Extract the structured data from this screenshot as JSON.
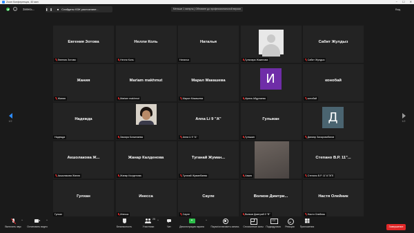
{
  "window": {
    "title": "Zoom Конференция, 40 мин",
    "controls": [
      "−",
      "☐",
      "✕"
    ]
  },
  "topbar": {
    "recording_label": "Запись...",
    "pill_controls": "❚❚ ■",
    "share_label": "Слайдаты ЮЖ распознают...",
    "notice": "Меньше 1 минуты | Обновите до профессиональной версии",
    "view_label": "Вид"
  },
  "pager": {
    "left": "1/2",
    "right": "1/2"
  },
  "colors": {
    "accent": "#2d8cff",
    "danger": "#e02828",
    "share": "#2dbf4a"
  },
  "tiles": [
    {
      "name": "Евгения Зотова",
      "label": "Евгения Зотова",
      "muted": true,
      "avatar": "none"
    },
    {
      "name": "Нелли Коль",
      "label": "Нелли Коль",
      "muted": true,
      "avatar": "none"
    },
    {
      "name": "Наталья",
      "label": "Наталья",
      "muted": false,
      "avatar": "none"
    },
    {
      "name": "",
      "label": "Гульнара Жакенова",
      "muted": true,
      "avatar": "photo-placeholder"
    },
    {
      "name": "Сабит Жулдыз",
      "label": "Сабит Жулдыз",
      "muted": true,
      "avatar": "none"
    },
    {
      "name": "Жания",
      "label": "Жания",
      "muted": true,
      "avatar": "none"
    },
    {
      "name": "Mariam makhmut",
      "label": "Mariam makhmut",
      "muted": true,
      "avatar": "none"
    },
    {
      "name": "Марал Макашева",
      "label": "Марал Макашева",
      "muted": true,
      "avatar": "none"
    },
    {
      "name": "",
      "label": "Ирина Абдулаева",
      "muted": true,
      "avatar": "letter",
      "letter": "И",
      "color": "#6f2da8"
    },
    {
      "name": "конобай",
      "label": "конобай",
      "muted": true,
      "avatar": "none"
    },
    {
      "name": "Надежда",
      "label": "Надежда",
      "muted": false,
      "avatar": "none"
    },
    {
      "name": "",
      "label": "Замира Конкатаева",
      "muted": true,
      "avatar": "face"
    },
    {
      "name": "Anna Li 9 \"A\"",
      "label": "Anna Li 9 \"A\"",
      "muted": true,
      "avatar": "none"
    },
    {
      "name": "Гульжан",
      "label": "Гульжан",
      "muted": true,
      "avatar": "none"
    },
    {
      "name": "",
      "label": "Данияр Захаровибатов",
      "muted": true,
      "avatar": "letter",
      "letter": "Д",
      "color": "#4a6470"
    },
    {
      "name": "Акшолакова Ж...",
      "label": "Акшолакова Жания",
      "muted": true,
      "avatar": "none"
    },
    {
      "name": "Жанар Калденова",
      "label": "Жанар Калденова",
      "muted": true,
      "avatar": "none"
    },
    {
      "name": "Туганай Жуман...",
      "label": "Туганай Жуманбаева",
      "muted": true,
      "avatar": "none"
    },
    {
      "name": "",
      "label": "Хакия",
      "muted": true,
      "avatar": "video"
    },
    {
      "name": "Степано В.Р. 11\"...",
      "label": "Степано В.Р. 11\"А\"ЭГЕ",
      "muted": true,
      "avatar": "none"
    },
    {
      "name": "Гулхан",
      "label": "Гулхан",
      "muted": false,
      "avatar": "none"
    },
    {
      "name": "Инесса",
      "label": "Инесса",
      "muted": true,
      "avatar": "none"
    },
    {
      "name": "Сауле",
      "label": "Сауле",
      "muted": true,
      "avatar": "none"
    },
    {
      "name": "Волков Дмитри...",
      "label": "Волков Дмитрий 5 \"В\"",
      "muted": true,
      "avatar": "none"
    },
    {
      "name": "Настя Олейник",
      "label": "Настя Олейник",
      "muted": true,
      "avatar": "none"
    }
  ],
  "toolbar": {
    "unmute": {
      "label": "Включить звук",
      "icon": "mic-muted-icon"
    },
    "start_video": {
      "label": "Остановить видео",
      "icon": "camera-icon"
    },
    "security": {
      "label": "Безопасность",
      "icon": "shield-icon"
    },
    "participants": {
      "label": "Участники",
      "count": "25",
      "icon": "people-icon"
    },
    "chat": {
      "label": "Чат",
      "icon": "chat-icon"
    },
    "share": {
      "label": "Демонстрация экрана",
      "icon": "share-screen-icon"
    },
    "record": {
      "label": "Пауза/остановить запись",
      "icon": "record-icon"
    },
    "rooms": {
      "label": "Сессионные залы",
      "icon": "breakout-rooms-icon"
    },
    "captions": {
      "label": "Подкадровка",
      "icon": "captions-icon"
    },
    "reactions": {
      "label": "Реакции",
      "icon": "smile-icon"
    },
    "apps": {
      "label": "Приложения",
      "icon": "apps-icon"
    },
    "end": {
      "label": "Завершение"
    }
  }
}
